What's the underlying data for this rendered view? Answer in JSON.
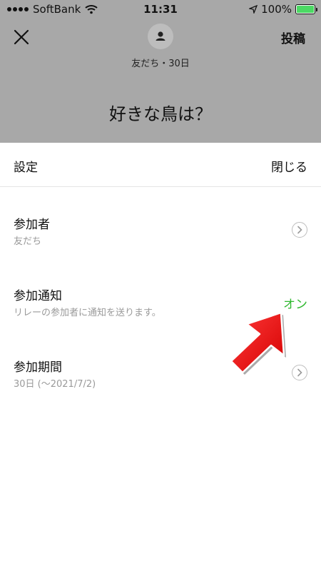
{
  "status_bar": {
    "carrier": "SoftBank",
    "time": "11:31",
    "battery": "100%"
  },
  "header": {
    "meta": "友だち・30日",
    "post_label": "投稿",
    "question": "好きな鳥は？"
  },
  "settings": {
    "title": "設定",
    "close_label": "閉じる",
    "items": [
      {
        "title": "参加者",
        "subtitle": "友だち"
      },
      {
        "title": "参加通知",
        "subtitle": "リレーの参加者に通知を送ります。",
        "value": "オン"
      },
      {
        "title": "参加期間",
        "subtitle": "30日 (〜2021/7/2)"
      }
    ]
  },
  "colors": {
    "accent_green": "#2eb82e",
    "dim_overlay": "#a8a8a8",
    "arrow_red": "#ff1a1a"
  },
  "icons": [
    "wifi-icon",
    "location-arrow-icon",
    "battery-icon",
    "close-icon",
    "user-avatar-icon",
    "chevron-right-icon",
    "pointer-arrow-icon"
  ]
}
